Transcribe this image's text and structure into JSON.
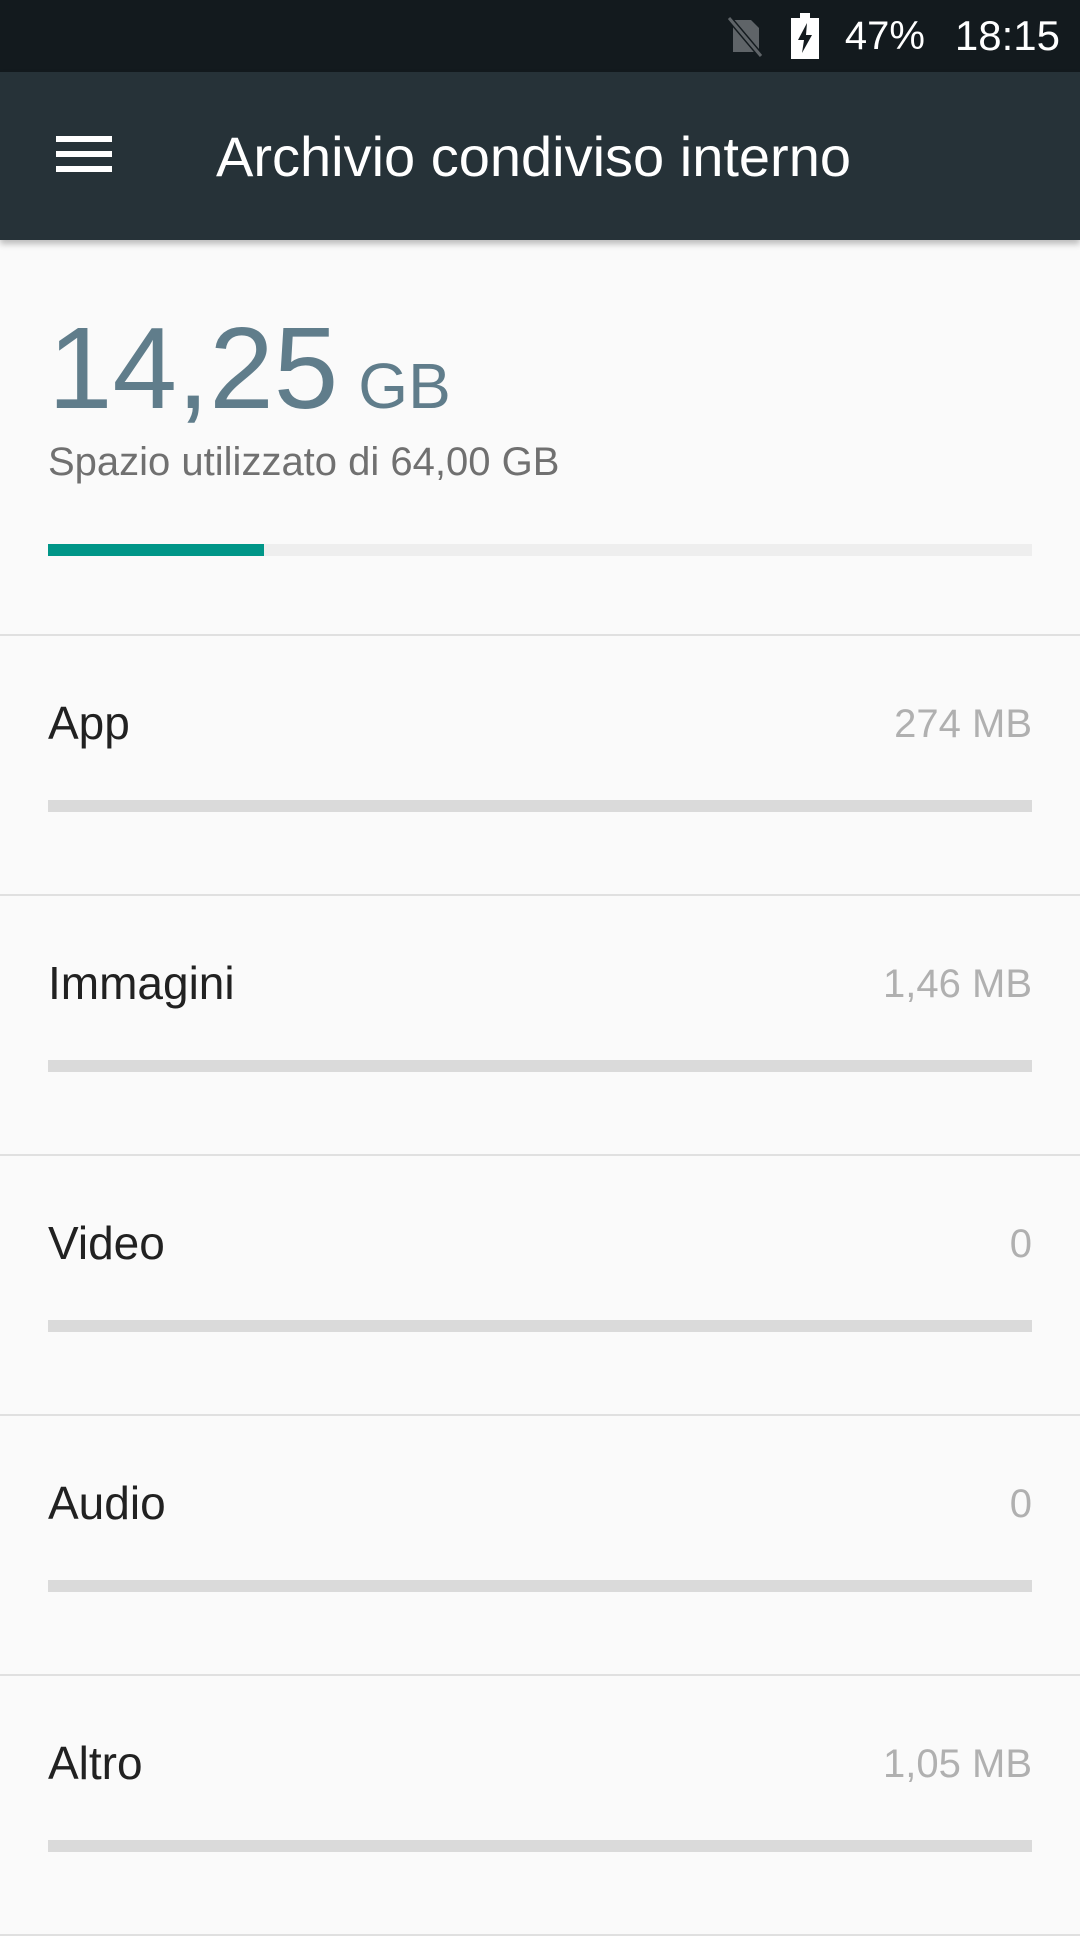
{
  "status_bar": {
    "icons": [
      "no-sim-icon",
      "battery-charging-icon"
    ],
    "battery_percent": "47%",
    "time": "18:15"
  },
  "app_bar": {
    "menu_icon": "menu-icon",
    "title": "Archivio condiviso interno"
  },
  "summary": {
    "used_value": "14,25",
    "used_unit": "GB",
    "description": "Spazio utilizzato di 64,00 GB",
    "used_fraction": 0.22,
    "color": "#009688"
  },
  "categories": [
    {
      "label": "App",
      "value": "274 MB",
      "fraction": 0
    },
    {
      "label": "Immagini",
      "value": "1,46 MB",
      "fraction": 0
    },
    {
      "label": "Video",
      "value": "0",
      "fraction": 0
    },
    {
      "label": "Audio",
      "value": "0",
      "fraction": 0
    },
    {
      "label": "Altro",
      "value": "1,05 MB",
      "fraction": 0
    }
  ]
}
